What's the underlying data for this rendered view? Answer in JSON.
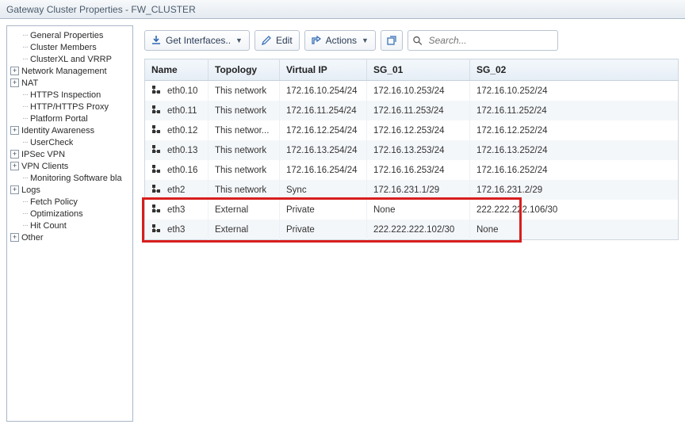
{
  "window": {
    "title": "Gateway Cluster Properties - FW_CLUSTER"
  },
  "tree": {
    "items": [
      {
        "label": "General Properties",
        "indent": true,
        "exp": ""
      },
      {
        "label": "Cluster Members",
        "indent": true,
        "exp": ""
      },
      {
        "label": "ClusterXL and VRRP",
        "indent": true,
        "exp": ""
      },
      {
        "label": "Network Management",
        "indent": false,
        "exp": "+"
      },
      {
        "label": "NAT",
        "indent": false,
        "exp": "+"
      },
      {
        "label": "HTTPS Inspection",
        "indent": true,
        "exp": ""
      },
      {
        "label": "HTTP/HTTPS Proxy",
        "indent": true,
        "exp": ""
      },
      {
        "label": "Platform Portal",
        "indent": true,
        "exp": ""
      },
      {
        "label": "Identity Awareness",
        "indent": false,
        "exp": "+"
      },
      {
        "label": "UserCheck",
        "indent": true,
        "exp": ""
      },
      {
        "label": "IPSec VPN",
        "indent": false,
        "exp": "+"
      },
      {
        "label": "VPN Clients",
        "indent": false,
        "exp": "+"
      },
      {
        "label": "Monitoring Software bla",
        "indent": true,
        "exp": ""
      },
      {
        "label": "Logs",
        "indent": false,
        "exp": "+"
      },
      {
        "label": "Fetch Policy",
        "indent": true,
        "exp": ""
      },
      {
        "label": "Optimizations",
        "indent": true,
        "exp": ""
      },
      {
        "label": "Hit Count",
        "indent": true,
        "exp": ""
      },
      {
        "label": "Other",
        "indent": false,
        "exp": "+"
      }
    ]
  },
  "toolbar": {
    "get_interfaces": "Get Interfaces..",
    "edit": "Edit",
    "actions": "Actions"
  },
  "search": {
    "placeholder": "Search..."
  },
  "table": {
    "headers": [
      "Name",
      "Topology",
      "Virtual IP",
      "SG_01",
      "SG_02"
    ],
    "rows": [
      {
        "name": "eth0.10",
        "topology": "This network",
        "vip": "172.16.10.254/24",
        "sg01": "172.16.10.253/24",
        "sg02": "172.16.10.252/24"
      },
      {
        "name": "eth0.11",
        "topology": "This network",
        "vip": "172.16.11.254/24",
        "sg01": "172.16.11.253/24",
        "sg02": "172.16.11.252/24"
      },
      {
        "name": "eth0.12",
        "topology": "This networ...",
        "vip": "172.16.12.254/24",
        "sg01": "172.16.12.253/24",
        "sg02": "172.16.12.252/24"
      },
      {
        "name": "eth0.13",
        "topology": "This network",
        "vip": "172.16.13.254/24",
        "sg01": "172.16.13.253/24",
        "sg02": "172.16.13.252/24"
      },
      {
        "name": "eth0.16",
        "topology": "This network",
        "vip": "172.16.16.254/24",
        "sg01": "172.16.16.253/24",
        "sg02": "172.16.16.252/24"
      },
      {
        "name": "eth2",
        "topology": "This network",
        "vip": "Sync",
        "sg01": "172.16.231.1/29",
        "sg02": "172.16.231.2/29"
      },
      {
        "name": "eth3",
        "topology": "External",
        "vip": "Private",
        "sg01": "None",
        "sg02": "222.222.222.106/30"
      },
      {
        "name": "eth3",
        "topology": "External",
        "vip": "Private",
        "sg01": "222.222.222.102/30",
        "sg02": "None"
      }
    ]
  }
}
